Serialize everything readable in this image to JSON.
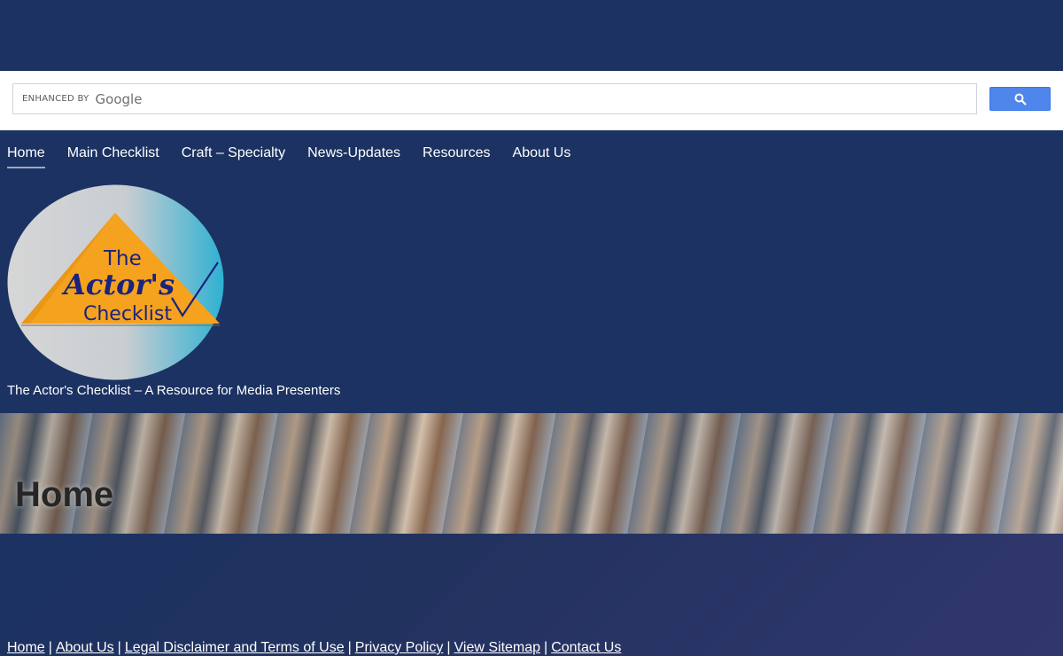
{
  "search": {
    "enhanced_label": "ENHANCED BY",
    "brand": "Google",
    "button_icon": "search-icon",
    "button_color": "#4f86ec"
  },
  "nav": {
    "items": [
      {
        "label": "Home",
        "active": true
      },
      {
        "label": "Main Checklist"
      },
      {
        "label": "Craft – Specialty"
      },
      {
        "label": "News-Updates"
      },
      {
        "label": "Resources"
      },
      {
        "label": "About Us"
      }
    ]
  },
  "logo": {
    "line1": "The",
    "line2": "Actor's",
    "line3": "Checklist"
  },
  "site": {
    "tagline": "The Actor's Checklist – A Resource for Media Presenters"
  },
  "hero": {
    "title": "Home"
  },
  "footer": {
    "links": [
      "Home",
      "About Us",
      "Legal Disclaimer and Terms of Use",
      "Privacy Policy",
      "View Sitemap",
      "Contact Us"
    ],
    "separator": "|"
  },
  "colors": {
    "background": "#1b3262",
    "logo_orange": "#f5a21f",
    "logo_text": "#1a237e"
  }
}
